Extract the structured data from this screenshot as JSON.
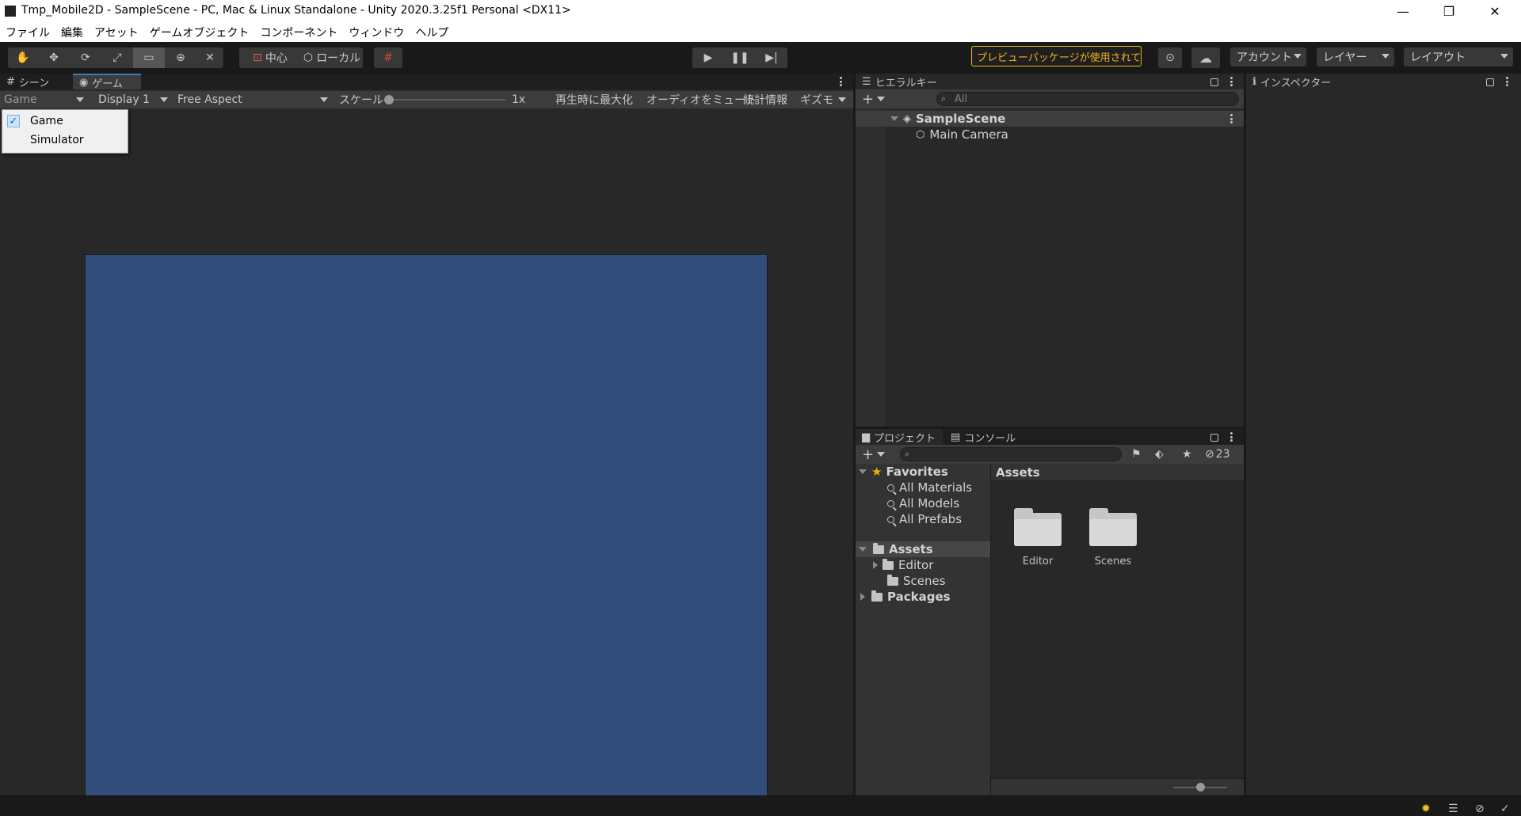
{
  "window": {
    "title": "Tmp_Mobile2D - SampleScene - PC, Mac & Linux Standalone - Unity 2020.3.25f1 Personal <DX11>",
    "minimize": "—",
    "maximize": "❐",
    "close": "✕"
  },
  "menu": [
    "ファイル",
    "編集",
    "アセット",
    "ゲームオブジェクト",
    "コンポーネント",
    "ウィンドウ",
    "ヘルプ"
  ],
  "toolbar": {
    "pivot_label": "中心",
    "space_label": "ローカル",
    "preview_notice": "プレビューパッケージが使用されています",
    "account_label": "アカウント",
    "layers_label": "レイヤー",
    "layout_label": "レイアウト",
    "play_state": "stopped"
  },
  "game_panel": {
    "tabs": [
      "シーン",
      "ゲーム"
    ],
    "active_tab": "ゲーム",
    "view_mode": "Game",
    "display": "Display 1",
    "aspect": "Free Aspect",
    "scale_label": "スケール",
    "scale_value": "1x",
    "maximize_on_play": "再生時に最大化",
    "mute_audio": "オーディオをミュート",
    "stats": "統計情報",
    "gizmos": "ギズモ",
    "viewport_color": "#314d79",
    "view_menu": {
      "options": [
        "Game",
        "Simulator"
      ],
      "checked": "Game"
    }
  },
  "hierarchy": {
    "tab": "ヒエラルキー",
    "search_placeholder": "All",
    "scene": "SampleScene",
    "objects": [
      "Main Camera"
    ]
  },
  "inspector": {
    "tab": "インスペクター"
  },
  "project": {
    "tabs": [
      "プロジェクト",
      "コンソール"
    ],
    "hidden_count": "23",
    "favorites_label": "Favorites",
    "favorites": [
      "All Materials",
      "All Models",
      "All Prefabs"
    ],
    "assets_label": "Assets",
    "asset_folders": [
      "Editor",
      "Scenes"
    ],
    "packages_label": "Packages",
    "breadcrumb": "Assets",
    "grid_items": [
      "Editor",
      "Scenes"
    ]
  }
}
